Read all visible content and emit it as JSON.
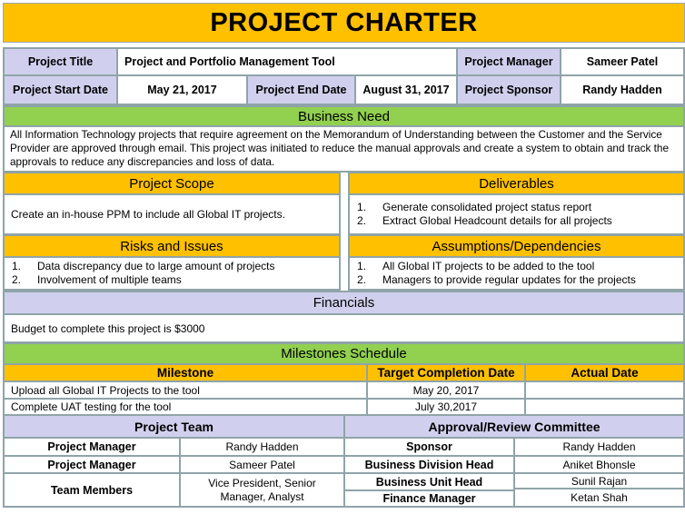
{
  "title": "PROJECT CHARTER",
  "info": {
    "project_title_label": "Project Title",
    "project_title": "Project and Portfolio Management Tool",
    "project_manager_label": "Project Manager",
    "project_manager": "Sameer Patel",
    "start_date_label": "Project Start Date",
    "start_date": "May 21, 2017",
    "end_date_label": "Project End Date",
    "end_date": "August 31, 2017",
    "sponsor_label": "Project Sponsor",
    "sponsor": "Randy Hadden"
  },
  "business_need": {
    "header": "Business Need",
    "text": "All  Information Technology projects that require agreement on the Memorandum of Understanding  between the Customer and the Service Provider are approved  through email. This project was initiated to reduce the manual approvals and create a system to obtain and track the approvals to reduce any discrepancies and loss of data."
  },
  "scope": {
    "header": "Project Scope",
    "text": "Create an in-house PPM to include all Global IT projects."
  },
  "deliverables": {
    "header": "Deliverables",
    "items": [
      {
        "num": "1.",
        "text": "Generate consolidated project status report"
      },
      {
        "num": "2.",
        "text": "Extract Global Headcount details for all projects"
      }
    ]
  },
  "risks": {
    "header": "Risks and Issues",
    "items": [
      {
        "num": "1.",
        "text": "Data discrepancy due to large amount of projects"
      },
      {
        "num": "2.",
        "text": "Involvement  of multiple teams"
      }
    ]
  },
  "assumptions": {
    "header": "Assumptions/Dependencies",
    "items": [
      {
        "num": "1.",
        "text": "All Global IT projects to be added to the tool"
      },
      {
        "num": "2.",
        "text": "Managers to provide regular updates for the projects"
      }
    ]
  },
  "financials": {
    "header": "Financials",
    "text": "Budget to complete this project is $3000"
  },
  "milestones": {
    "header": "Milestones  Schedule",
    "columns": [
      "Milestone",
      "Target Completion Date",
      "Actual Date"
    ],
    "rows": [
      {
        "milestone": "Upload all Global IT Projects to the tool",
        "target": "May 20, 2017",
        "actual": ""
      },
      {
        "milestone": "Complete UAT testing for the tool",
        "target": "July 30,2017",
        "actual": ""
      }
    ]
  },
  "team": {
    "header": "Project Team",
    "rows": [
      {
        "role": "Project Manager",
        "name": "Randy Hadden"
      },
      {
        "role": "Project Manager",
        "name": "Sameer Patel"
      },
      {
        "role": "Team Members",
        "name": "Vice President, Senior Manager, Analyst"
      }
    ]
  },
  "committee": {
    "header": "Approval/Review Committee",
    "rows": [
      {
        "role": "Sponsor",
        "name": "Randy Hadden"
      },
      {
        "role": "Business Division Head",
        "name": "Aniket Bhonsle"
      },
      {
        "role": "Business Unit Head",
        "name": "Sunil Rajan"
      },
      {
        "role": "Finance Manager",
        "name": "Ketan Shah"
      }
    ]
  }
}
